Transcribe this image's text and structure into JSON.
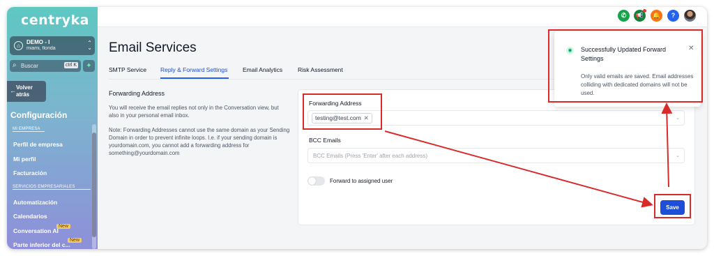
{
  "sidebar": {
    "logo": "centryka",
    "account": {
      "name": "DEMO - I",
      "location": "miami, florida"
    },
    "search": {
      "placeholder": "Buscar",
      "shortcut": "ctrl K"
    },
    "back_label": "Volver atrás",
    "config_title": "Configuración",
    "sections": [
      {
        "title": "MI EMPRESA",
        "items": [
          "Perfil de empresa",
          "Mi perfil",
          "Facturación"
        ]
      },
      {
        "title": "SERVICIOS EMPRESARIALES",
        "items": [
          "Automatización",
          "Calendarios",
          "Conversation AI",
          "Parte inferior del c..."
        ]
      }
    ],
    "badges": {
      "new": "New"
    }
  },
  "topbar": {
    "icons": [
      "phone-icon",
      "megaphone-icon",
      "bell-icon",
      "help-icon",
      "avatar"
    ],
    "colors": {
      "phone": "#16a34a",
      "megaphone": "#15803d",
      "bell": "#f97316",
      "help": "#2563eb"
    },
    "help_glyph": "?"
  },
  "main": {
    "title": "Email Services",
    "tabs": [
      {
        "label": "SMTP Service",
        "active": false
      },
      {
        "label": "Reply & Forward Settings",
        "active": true
      },
      {
        "label": "Email Analytics",
        "active": false
      },
      {
        "label": "Risk Assessment",
        "active": false
      }
    ],
    "left": {
      "title": "Forwarding Address",
      "desc1": "You will receive the email replies not only in the Conversation view, but also in your personal email inbox.",
      "desc2": "Note: Forwarding Addresses cannot use the same domain as your Sending Domain in order to prevent infinite loops. I.e. if your sending domain is yourdomain.com, you cannot add a forwarding address for something@yourdomain.com"
    },
    "form": {
      "forwarding_label": "Forwarding Address",
      "forwarding_value": "testing@test.com",
      "bcc_label": "BCC Emails",
      "bcc_placeholder": "BCC Emails (Press 'Enter' after each address)",
      "toggle_label": "Forward to assigned user",
      "toggle_on": false,
      "save_label": "Save"
    }
  },
  "toast": {
    "title": "Successfully Updated Forward Settings",
    "message": "Only valid emails are saved. Email addresses colliding with dedicated domains will not be used."
  },
  "colors": {
    "accent": "#1d4ed8",
    "annotation": "#d92a2a"
  }
}
